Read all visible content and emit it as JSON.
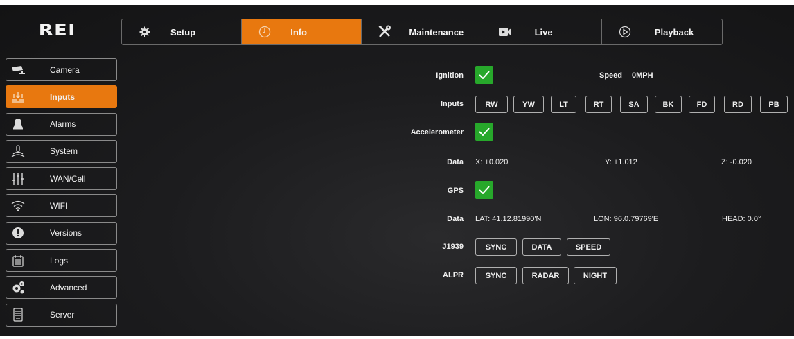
{
  "logo": {
    "text": "REI"
  },
  "topnav": {
    "tabs": [
      {
        "label": "Setup",
        "icon": "gear-icon"
      },
      {
        "label": "Info",
        "icon": "clock-icon",
        "active": true
      },
      {
        "label": "Maintenance",
        "icon": "tools-icon"
      },
      {
        "label": "Live",
        "icon": "video-camera-icon"
      },
      {
        "label": "Playback",
        "icon": "play-circle-icon"
      }
    ]
  },
  "sidebar": {
    "items": [
      {
        "label": "Camera",
        "icon": "cctv-camera-icon"
      },
      {
        "label": "Inputs",
        "icon": "inputs-icon",
        "active": true
      },
      {
        "label": "Alarms",
        "icon": "bell-icon"
      },
      {
        "label": "System",
        "icon": "system-icon"
      },
      {
        "label": "WAN/Cell",
        "icon": "sliders-icon"
      },
      {
        "label": "WIFI",
        "icon": "wifi-icon"
      },
      {
        "label": "Versions",
        "icon": "info-icon"
      },
      {
        "label": "Logs",
        "icon": "calendar-icon"
      },
      {
        "label": "Advanced",
        "icon": "gears-icon"
      },
      {
        "label": "Server",
        "icon": "server-icon"
      }
    ]
  },
  "info": {
    "ignition": {
      "label": "Ignition",
      "checked": true
    },
    "speed": {
      "label": "Speed",
      "value": "0MPH"
    },
    "inputs": {
      "label": "Inputs",
      "buttons": [
        "RW",
        "YW",
        "LT",
        "RT",
        "SA",
        "BK",
        "FD",
        "RD",
        "PB"
      ]
    },
    "accelerometer": {
      "label": "Accelerometer",
      "checked": true
    },
    "accel_data": {
      "label": "Data",
      "x": "X: +0.020",
      "y": "Y: +1.012",
      "z": "Z: -0.020"
    },
    "gps": {
      "label": "GPS",
      "checked": true
    },
    "gps_data": {
      "label": "Data",
      "lat": "LAT: 41.12.81990'N",
      "lon": "LON: 96.0.79769'E",
      "head": "HEAD: 0.0°"
    },
    "j1939": {
      "label": "J1939",
      "buttons": [
        "SYNC",
        "DATA",
        "SPEED"
      ]
    },
    "alpr": {
      "label": "ALPR",
      "buttons": [
        "SYNC",
        "RADAR",
        "NIGHT"
      ]
    }
  },
  "colors": {
    "accent": "#e8780f",
    "check": "#27a82b",
    "background": "#1c1c1e"
  }
}
